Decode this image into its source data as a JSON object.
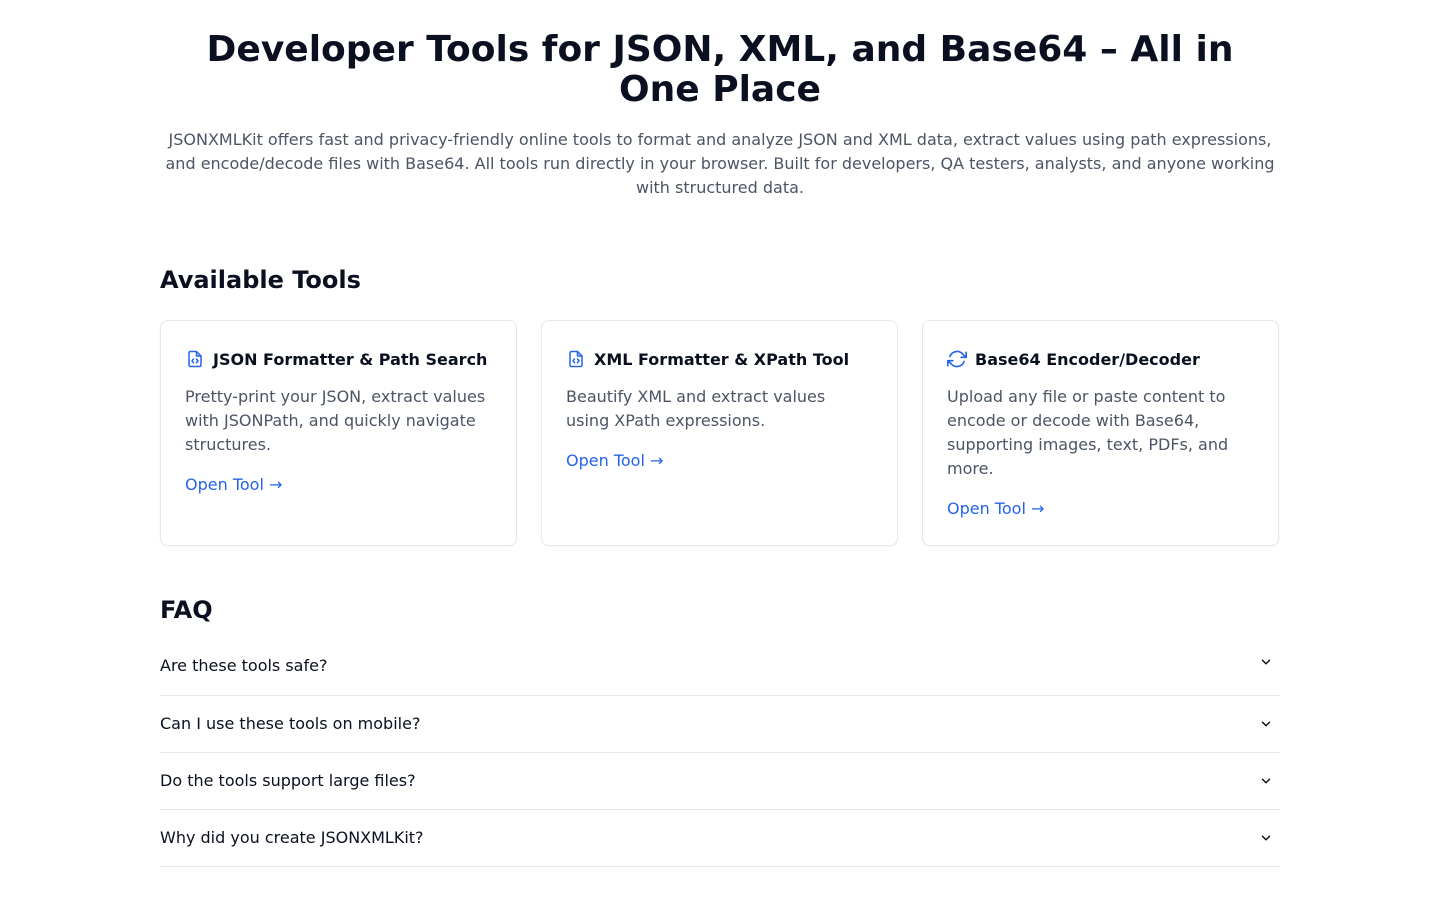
{
  "hero": {
    "title": "Developer Tools for JSON, XML, and Base64 – All in One Place",
    "description": "JSONXMLKit offers fast and privacy-friendly online tools to format and analyze JSON and XML data, extract values using path expressions, and encode/decode files with Base64. All tools run directly in your browser. Built for developers, QA testers, analysts, and anyone working with structured data."
  },
  "tools": {
    "heading": "Available Tools",
    "cards": [
      {
        "icon": "file-code-icon",
        "title": "JSON Formatter & Path Search",
        "description": "Pretty-print your JSON, extract values with JSONPath, and quickly navigate structures.",
        "link": "Open Tool →"
      },
      {
        "icon": "file-code-icon",
        "title": "XML Formatter & XPath Tool",
        "description": "Beautify XML and extract values using XPath expressions.",
        "link": "Open Tool →"
      },
      {
        "icon": "refresh-icon",
        "title": "Base64 Encoder/Decoder",
        "description": "Upload any file or paste content to encode or decode with Base64, supporting images, text, PDFs, and more.",
        "link": "Open Tool →"
      }
    ]
  },
  "faq": {
    "heading": "FAQ",
    "items": [
      {
        "question": "Are these tools safe?"
      },
      {
        "question": "Can I use these tools on mobile?"
      },
      {
        "question": "Do the tools support large files?"
      },
      {
        "question": "Why did you create JSONXMLKit?"
      }
    ]
  },
  "colors": {
    "accent": "#2563eb",
    "text": "#0b1020",
    "muted": "#4b5563",
    "border": "#e5e7eb"
  }
}
